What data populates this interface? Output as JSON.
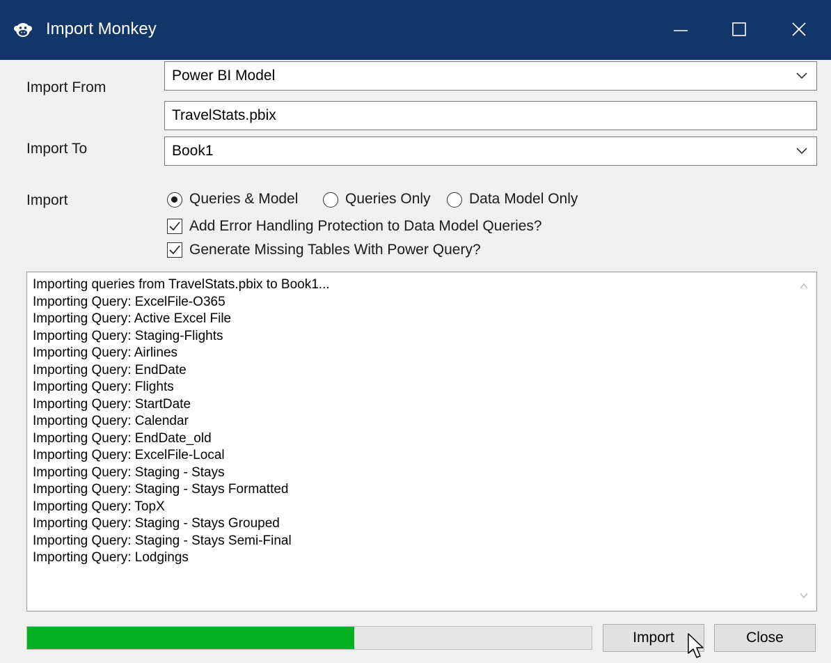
{
  "window": {
    "title": "Import Monkey",
    "app_icon": "monkey-icon",
    "titlebar_color": "#123667",
    "controls": [
      "minimize-icon",
      "maximize-icon",
      "close-icon"
    ]
  },
  "form": {
    "import_from_label": "Import From",
    "import_from_value": "Power BI Model",
    "file_value": "TravelStats.pbix",
    "import_to_label": "Import To",
    "import_to_value": "Book1",
    "import_label": "Import"
  },
  "import_options": [
    {
      "label": "Queries & Model",
      "selected": true
    },
    {
      "label": "Queries Only",
      "selected": false
    },
    {
      "label": "Data Model Only",
      "selected": false
    }
  ],
  "checkboxes": [
    {
      "label": "Add Error Handling Protection to Data Model Queries?",
      "checked": true
    },
    {
      "label": "Generate Missing Tables With Power Query?",
      "checked": true
    }
  ],
  "log": [
    "Importing queries from TravelStats.pbix to Book1...",
    "Importing Query: ExcelFile-O365",
    "Importing Query: Active Excel File",
    "Importing Query: Staging-Flights",
    "Importing Query: Airlines",
    "Importing Query: EndDate",
    "Importing Query: Flights",
    "Importing Query: StartDate",
    "Importing Query: Calendar",
    "Importing Query: EndDate_old",
    "Importing Query: ExcelFile-Local",
    "Importing Query: Staging - Stays",
    "Importing Query: Staging - Stays Formatted",
    "Importing Query: TopX",
    "Importing Query: Staging - Stays Grouped",
    "Importing Query: Staging - Stays Semi-Final",
    "Importing Query: Lodgings"
  ],
  "progress": {
    "percent": 58,
    "color": "#06b025"
  },
  "buttons": {
    "import_label": "Import",
    "close_label": "Close"
  }
}
